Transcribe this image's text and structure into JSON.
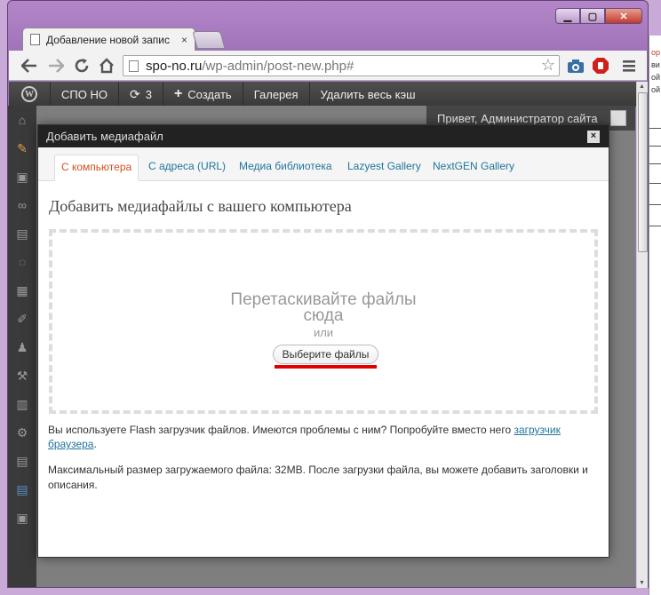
{
  "browser": {
    "tab_title": "Добавление новой запис",
    "tab_close": "×",
    "url_host": "spo-no.ru",
    "url_path": "/wp-admin/post-new.php#",
    "controls": {
      "minimize": "▁",
      "maximize": "▢",
      "close": "✕"
    }
  },
  "wp_toolbar": {
    "site_name": "СПО НО",
    "updates_count": "3",
    "new_label": "Создать",
    "gallery_label": "Галерея",
    "clear_cache_label": "Удалить весь кэш",
    "greeting": "Привет, Администратор сайта"
  },
  "modal": {
    "title": "Добавить медиафайл",
    "close": "×",
    "tabs": [
      {
        "label": "С компьютера"
      },
      {
        "label": "С адреса (URL)"
      },
      {
        "label": "Медиа библиотека"
      },
      {
        "label": "Lazyest Gallery"
      },
      {
        "label": "NextGEN Gallery"
      }
    ],
    "active_tab": "С компьютера",
    "heading": "Добавить медиафайлы с вашего компьютера",
    "drop_line1": "Перетаскивайте файлы",
    "drop_line2": "сюда",
    "drop_or": "или",
    "select_button": "Выберите файлы",
    "flash_note_text": "Вы используете Flash загрузчик файлов. Имеются проблемы с ним? Попробуйте вместо него ",
    "flash_note_link": "загрузчик браузера",
    "flash_note_end": ".",
    "max_size_note": "Максимальный размер загружаемого файла: 32MB. После загрузки файла, вы можете добавить заголовки и описания."
  },
  "background_window": {
    "lines": [
      "ор",
      "ви",
      "ой",
      "ой"
    ]
  },
  "colors": {
    "active_tab": "#d54e21",
    "link": "#21759b",
    "highlight": "#e00000",
    "admin_bar": "#464646"
  }
}
